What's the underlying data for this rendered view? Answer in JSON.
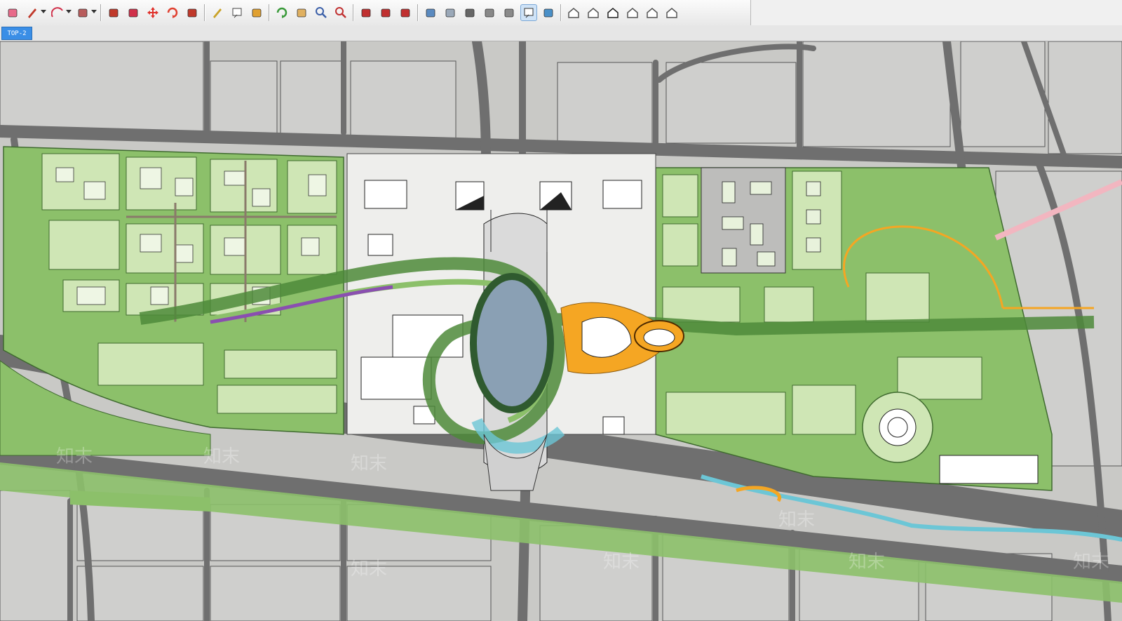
{
  "toolbar": {
    "tools": [
      {
        "name": "eraser-icon",
        "color": "#e86a8a"
      },
      {
        "name": "pencil-icon",
        "color": "#c0392b"
      },
      {
        "name": "arc-icon",
        "color": "#d0304a"
      },
      {
        "name": "rectangle-icon",
        "color": "#b85c5c"
      },
      {
        "name": "push-pull-icon",
        "color": "#c0392b"
      },
      {
        "name": "follow-me-icon",
        "color": "#d0304a"
      },
      {
        "name": "move-icon",
        "color": "#e0302a"
      },
      {
        "name": "rotate-icon",
        "color": "#e04030"
      },
      {
        "name": "scale-icon",
        "color": "#c0392b"
      },
      {
        "name": "tape-measure-icon",
        "color": "#c9a227"
      },
      {
        "name": "text-icon",
        "color": "#444444"
      },
      {
        "name": "paint-bucket-icon",
        "color": "#e0a030"
      },
      {
        "name": "orbit-icon",
        "color": "#3a9a3a"
      },
      {
        "name": "pan-icon",
        "color": "#e0b060"
      },
      {
        "name": "zoom-icon",
        "color": "#3a5fa8"
      },
      {
        "name": "zoom-extents-icon",
        "color": "#c03030"
      },
      {
        "name": "warehouse-icon",
        "color": "#c03030"
      },
      {
        "name": "share-model-icon",
        "color": "#c03030"
      },
      {
        "name": "get-models-icon",
        "color": "#c03030"
      },
      {
        "name": "xray-icon",
        "color": "#5a8ac0"
      },
      {
        "name": "back-edges-icon",
        "color": "#9aa8b8"
      },
      {
        "name": "wireframe-icon",
        "color": "#666666"
      },
      {
        "name": "hidden-line-icon",
        "color": "#888888"
      },
      {
        "name": "shaded-icon",
        "color": "#8a8a8a"
      },
      {
        "name": "shaded-textures-icon",
        "color": "#333333"
      },
      {
        "name": "monochrome-icon",
        "color": "#4a90c8"
      },
      {
        "name": "iso-view-icon",
        "color": "#555555"
      },
      {
        "name": "top-view-icon",
        "color": "#555555"
      },
      {
        "name": "front-view-icon",
        "color": "#222222"
      },
      {
        "name": "right-view-icon",
        "color": "#555555"
      },
      {
        "name": "back-view-icon",
        "color": "#555555"
      },
      {
        "name": "left-view-icon",
        "color": "#555555"
      }
    ],
    "active_tool": "shaded-textures-icon"
  },
  "scene_tab": {
    "label": "TOP-2"
  },
  "viewport": {
    "view": "top",
    "watermark": "知末",
    "colors": {
      "block": "#cfcfcd",
      "road": "#6f6f6f",
      "green": "#8cc06a",
      "light_green": "#cfe6b5",
      "dark_green": "#4d8a3a",
      "orange": "#f5a623",
      "water": "#6cc6d6",
      "building": "#ffffff"
    }
  }
}
